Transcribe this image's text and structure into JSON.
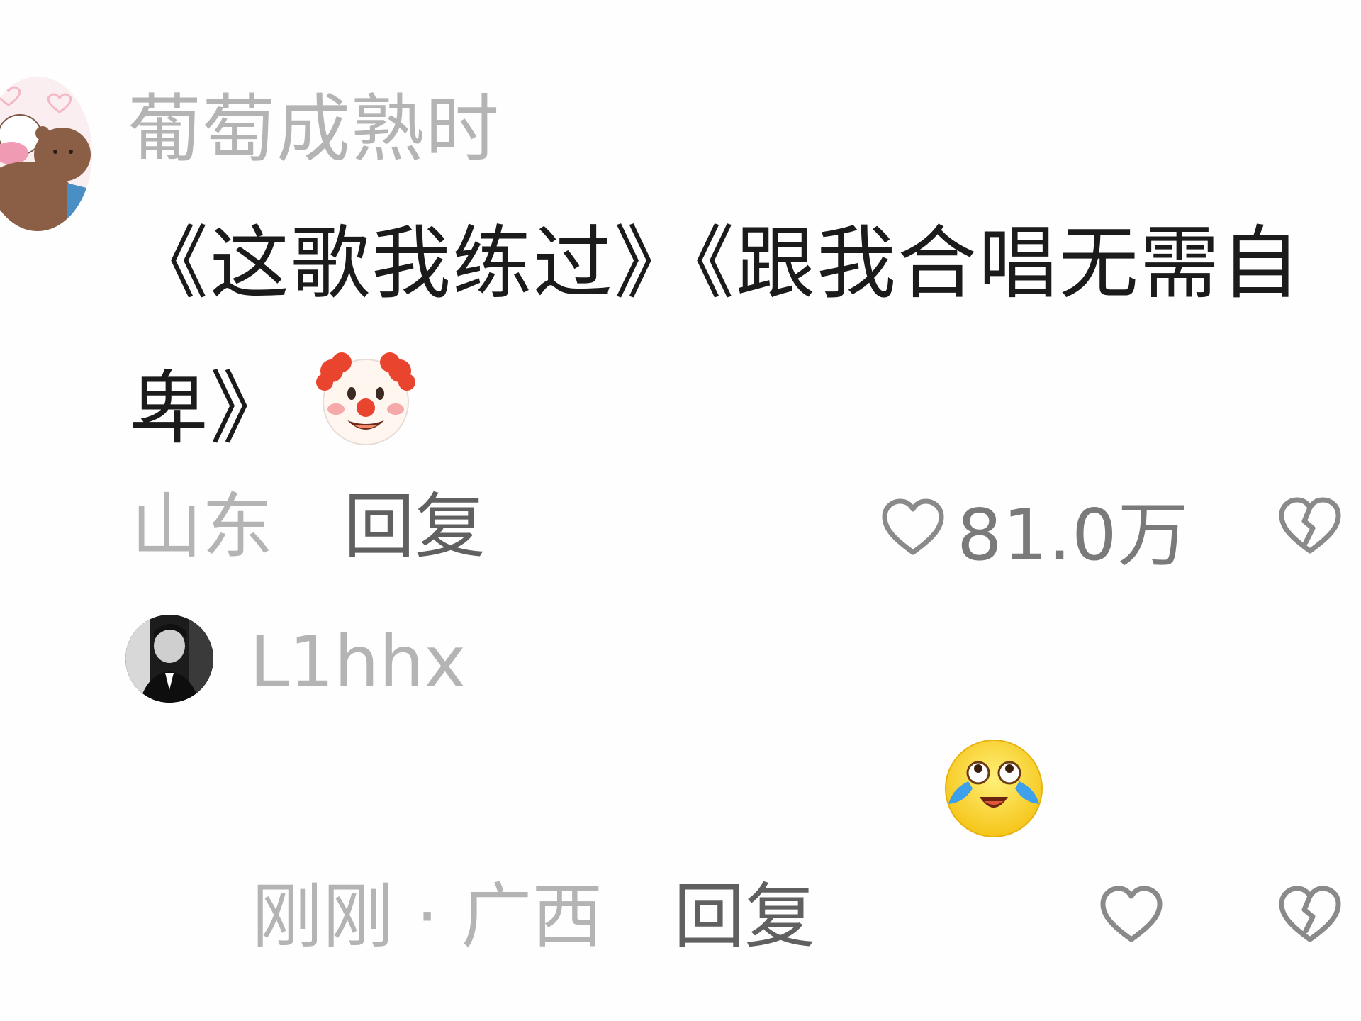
{
  "comment": {
    "username": "葡萄成熟时",
    "text": "《这歌我练过》《跟我合唱无需自卑》",
    "emoji": "clown-face-icon",
    "region": "山东",
    "reply_label": "回复",
    "like_count": "81.0万"
  },
  "reply": {
    "username": "L1hhx",
    "emoji": "laughing-crying-face-icon",
    "time_region": "刚刚 · 广西",
    "reply_label": "回复"
  },
  "colors": {
    "secondary_text": "#b4b4b4",
    "primary_text": "#1b1b1b",
    "action_text": "#606060",
    "background": "#fefefe"
  }
}
